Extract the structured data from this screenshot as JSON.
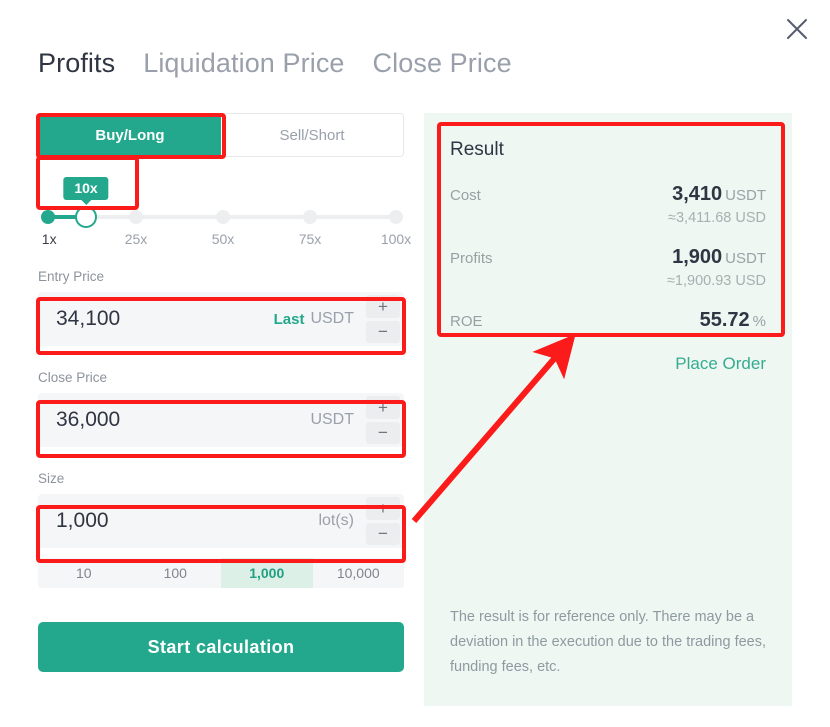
{
  "window": {
    "close_icon": "close-icon"
  },
  "tabs": [
    {
      "label": "Profits",
      "active": true
    },
    {
      "label": "Liquidation Price",
      "active": false
    },
    {
      "label": "Close Price",
      "active": false
    }
  ],
  "side_toggle": {
    "buy_label": "Buy/Long",
    "sell_label": "Sell/Short",
    "selected": "Buy/Long"
  },
  "leverage": {
    "tooltip": "10x",
    "value": 10,
    "min": 1,
    "max": 100,
    "ticks": [
      "1x",
      "25x",
      "50x",
      "75x",
      "100x"
    ]
  },
  "entry_price": {
    "label": "Entry Price",
    "value": "34,100",
    "badge": "Last",
    "unit": "USDT",
    "plus": "+",
    "minus": "−"
  },
  "close_price": {
    "label": "Close Price",
    "value": "36,000",
    "unit": "USDT",
    "plus": "+",
    "minus": "−"
  },
  "size": {
    "label": "Size",
    "value": "1,000",
    "unit": "lot(s)",
    "plus": "+",
    "minus": "−",
    "quick_options": [
      "10",
      "100",
      "1,000",
      "10,000"
    ],
    "quick_selected": "1,000"
  },
  "start_button": {
    "label": "Start calculation"
  },
  "result": {
    "title": "Result",
    "cost_label": "Cost",
    "cost_value": "3,410",
    "cost_unit": "USDT",
    "cost_approx": "≈3,411.68 USD",
    "profits_label": "Profits",
    "profits_value": "1,900",
    "profits_unit": "USDT",
    "profits_approx": "≈1,900.93 USD",
    "roe_label": "ROE",
    "roe_value": "55.72",
    "roe_unit": "%",
    "place_order_label": "Place Order",
    "disclaimer": "The result is for reference only. There may be a deviation in the execution due to the trading fees, funding fees, etc."
  },
  "colors": {
    "accent_green": "#24a88a",
    "annotation_red": "#fc1b1b",
    "panel_bg": "#eef7f2",
    "text_dark": "#2f3542",
    "text_muted": "#9aa0ab"
  }
}
